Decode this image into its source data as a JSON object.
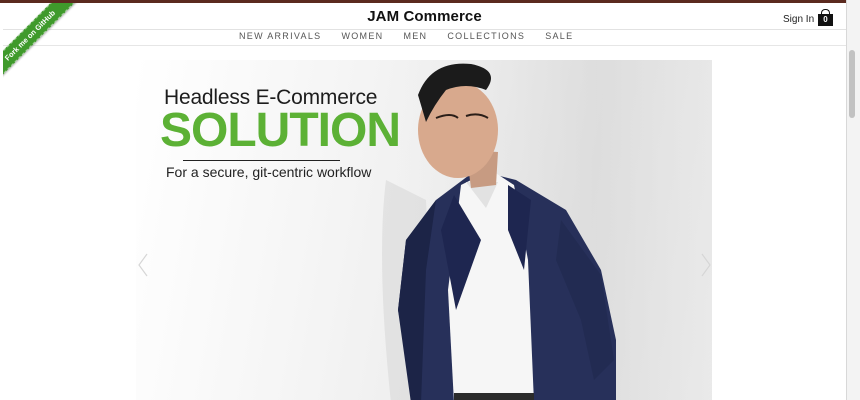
{
  "header": {
    "title": "JAM Commerce",
    "sign_in_label": "Sign In",
    "cart_count": "0"
  },
  "nav": {
    "items": [
      "NEW ARRIVALS",
      "WOMEN",
      "MEN",
      "COLLECTIONS",
      "SALE"
    ]
  },
  "ribbon": {
    "label": "Fork me on GitHub"
  },
  "hero": {
    "line1": "Headless E-Commerce",
    "line2": "SOLUTION",
    "line3": "For a secure, git-centric workflow",
    "accent_color": "#5cb135",
    "prev_icon": "chevron-left-icon",
    "next_icon": "chevron-right-icon"
  },
  "colors": {
    "ribbon": "#3f9a2b",
    "accent": "#5cb135",
    "window_border": "#5b2a1f"
  }
}
